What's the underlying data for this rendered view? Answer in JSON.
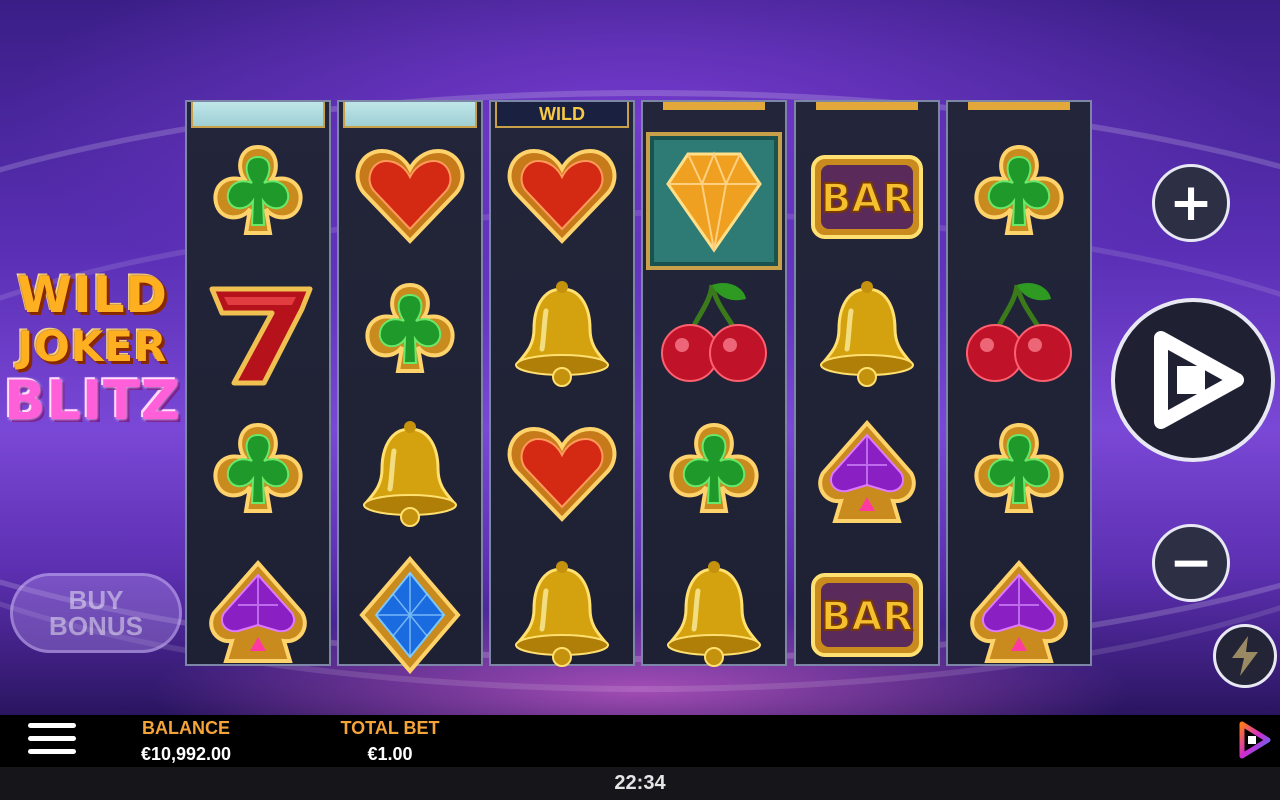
{
  "game": {
    "logo_lines": [
      "WILD",
      "JOKER",
      "BLITZ"
    ],
    "buy_bonus_label": "BUY\nBONUS",
    "peek_wild_label": "WILD"
  },
  "reels": [
    {
      "peek": "ice",
      "symbols": [
        "club-icon",
        "seven-icon",
        "club-icon",
        "spade-gem-icon"
      ]
    },
    {
      "peek": "ice",
      "symbols": [
        "heart-icon",
        "club-icon",
        "bell-icon",
        "diamond-gem-icon"
      ]
    },
    {
      "peek": "wild",
      "symbols": [
        "heart-icon",
        "bell-icon",
        "heart-icon",
        "bell-icon"
      ]
    },
    {
      "peek": "gold",
      "symbols": [
        "big-diamond-icon",
        "cherry-icon",
        "club-icon",
        "bell-icon"
      ]
    },
    {
      "peek": "gold",
      "symbols": [
        "bar-icon",
        "bell-icon",
        "spade-gem-icon",
        "bar-icon"
      ]
    },
    {
      "peek": "gold",
      "symbols": [
        "club-icon",
        "cherry-icon",
        "club-icon",
        "spade-gem-icon"
      ]
    }
  ],
  "bar_symbol_text": "BAR",
  "controls": {
    "increase_glyph": "+",
    "decrease_glyph": "−",
    "spin_icon": "spin-play-icon",
    "turbo_icon": "lightning-icon"
  },
  "footer": {
    "balance_label": "BALANCE",
    "balance_value": "€10,992.00",
    "total_bet_label": "TOTAL BET",
    "total_bet_value": "€1.00",
    "menu_icon": "hamburger-menu-icon",
    "brand_icon": "provider-logo-icon"
  },
  "clock": "22:34",
  "colors": {
    "balance_label": "#f5a43a",
    "background_purple": "#5a2fb5",
    "reel_bg": "#23253a"
  }
}
